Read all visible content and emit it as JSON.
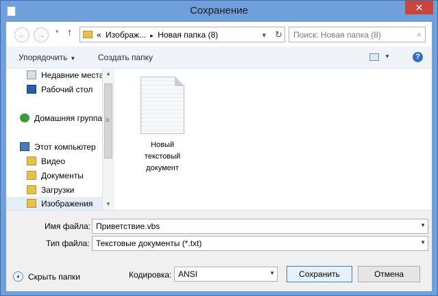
{
  "window": {
    "title": "Сохранение",
    "close_glyph": "✕"
  },
  "nav": {
    "back_glyph": "←",
    "forward_glyph": "→",
    "dropdown_glyph": "▾",
    "up_glyph": "↑"
  },
  "address": {
    "prefix": "«",
    "crumbs": [
      "Изображ...",
      "▸",
      "Новая папка (8)"
    ],
    "dropdown_glyph": "▾",
    "refresh_glyph": "↻"
  },
  "search": {
    "placeholder": "Поиск: Новая папка (8)",
    "icon_glyph": "⌕"
  },
  "toolbar": {
    "organize_label": "Упорядочить",
    "organize_arrow": "▼",
    "new_folder_label": "Создать папку",
    "view_arrow": "▼",
    "help_glyph": "?"
  },
  "sidebar": {
    "items": [
      {
        "label": "Недавние места",
        "icon": "recent-places-icon"
      },
      {
        "label": "Рабочий стол",
        "icon": "desktop-icon"
      },
      {
        "label": "Домашняя группа",
        "icon": "homegroup-icon"
      },
      {
        "label": "Этот компьютер",
        "icon": "computer-icon"
      },
      {
        "label": "Видео",
        "icon": "folder-icon"
      },
      {
        "label": "Документы",
        "icon": "folder-icon"
      },
      {
        "label": "Загрузки",
        "icon": "downloads-icon"
      },
      {
        "label": "Изображения",
        "icon": "folder-icon",
        "selected": true
      }
    ]
  },
  "scrollbar": {
    "up_glyph": "▲",
    "down_glyph": "▼",
    "grip_glyph": "≡"
  },
  "files": [
    {
      "name": "Новый\nтекстовый\nдокумент",
      "icon": "text-document-icon"
    }
  ],
  "form": {
    "filename_label": "Имя файла:",
    "filename_value": "Приветствие.vbs",
    "filetype_label": "Тип файла:",
    "filetype_value": "Текстовые документы (*.txt)",
    "encoding_label": "Кодировка:",
    "encoding_value": "ANSI",
    "combo_arrow": "▼"
  },
  "footer": {
    "hide_folders_label": "Скрыть папки",
    "hide_folders_glyph": "▲",
    "save_label": "Сохранить",
    "cancel_label": "Отмена"
  },
  "colors": {
    "title_bg": "#6fa0dc",
    "accent": "#3c7fb1",
    "folder": "#e8c14c"
  }
}
